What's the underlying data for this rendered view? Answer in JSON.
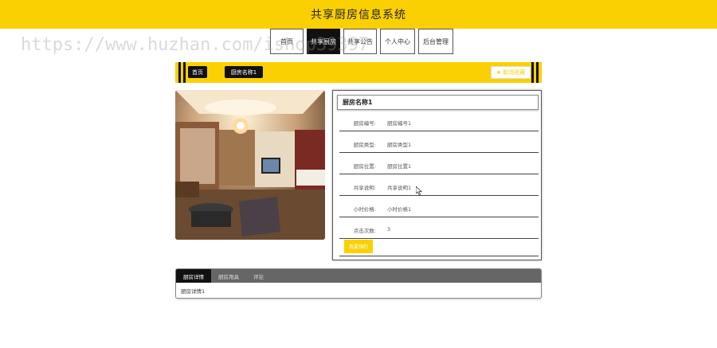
{
  "header": {
    "title": "共享厨房信息系统"
  },
  "nav": {
    "items": [
      "首页",
      "共享厨房",
      "共享公告",
      "个人中心",
      "后台管理"
    ],
    "active_index": 1
  },
  "watermark": "https://www.huzhan.com/ishop39397",
  "breadcrumb": {
    "home": "首页",
    "current": "厨房名称1",
    "favorite_label": "取消收藏"
  },
  "detail": {
    "title": "厨房名称1",
    "fields": [
      {
        "label": "厨房编号:",
        "value": "厨房编号1"
      },
      {
        "label": "厨房类型:",
        "value": "厨房类型1"
      },
      {
        "label": "厨房位置:",
        "value": "厨房位置1"
      },
      {
        "label": "共享说明:",
        "value": "共享说明1"
      },
      {
        "label": "小时价格:",
        "value": "小时价格1"
      },
      {
        "label": "点击次数:",
        "value": "3"
      }
    ],
    "book_label": "我要预约"
  },
  "tabs": {
    "items": [
      "厨房详情",
      "厨房用具",
      "评论"
    ],
    "active_index": 0,
    "content": "厨房详情1"
  },
  "colors": {
    "brand": "#fbd003",
    "dark": "#111111",
    "tabbar": "#666666"
  }
}
